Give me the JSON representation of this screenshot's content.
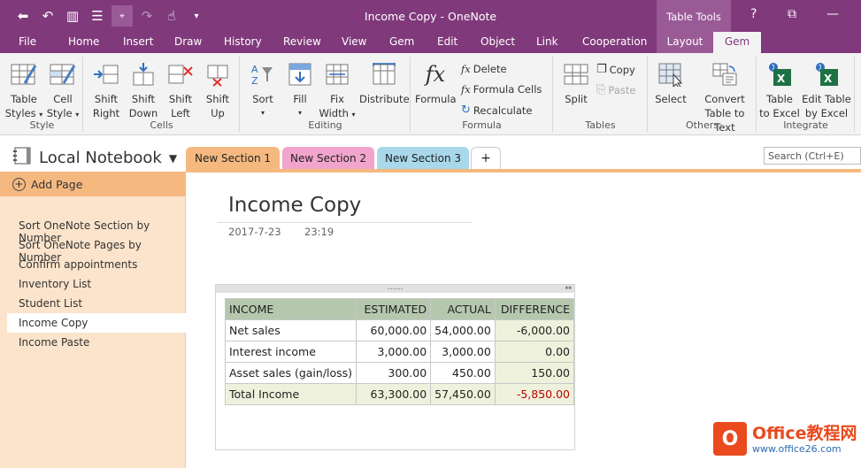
{
  "window": {
    "title": "Income Copy - OneNote",
    "context_tab_group": "Table Tools",
    "help": "?"
  },
  "ribbon_tabs": [
    "File",
    "Home",
    "Insert",
    "Draw",
    "History",
    "Review",
    "View",
    "Gem",
    "Edit",
    "Object",
    "Link",
    "Cooperation",
    "Layout",
    "Gem"
  ],
  "ribbon": {
    "style": {
      "label": "Style",
      "table_styles": [
        "Table",
        "Styles"
      ],
      "cell_style": [
        "Cell",
        "Style"
      ]
    },
    "cells": {
      "label": "Cells",
      "shift_right": [
        "Shift",
        "Right"
      ],
      "shift_down": [
        "Shift",
        "Down"
      ],
      "shift_left": [
        "Shift",
        "Left"
      ],
      "shift_up": [
        "Shift",
        "Up"
      ]
    },
    "editing": {
      "label": "Editing",
      "sort": "Sort",
      "fill": "Fill",
      "fix_width": [
        "Fix",
        "Width"
      ],
      "distribute": "Distribute"
    },
    "formula": {
      "label": "Formula",
      "formula": "Formula",
      "delete": "Delete",
      "formula_cells": "Formula Cells",
      "recalculate": "Recalculate"
    },
    "tables": {
      "label": "Tables",
      "split": "Split",
      "copy": "Copy",
      "paste": "Paste"
    },
    "others": {
      "label": "Others",
      "select": "Select",
      "convert": [
        "Convert",
        "Table to Text"
      ]
    },
    "integrate": {
      "label": "Integrate",
      "table_to_excel": [
        "Table",
        "to Excel"
      ],
      "edit_table": [
        "Edit Table",
        "by Excel"
      ]
    }
  },
  "notebook": {
    "name": "Local Notebook"
  },
  "sections": [
    {
      "label": "New Section 1",
      "color": "#f5b980"
    },
    {
      "label": "New Section 2",
      "color": "#f2a5cc"
    },
    {
      "label": "New Section 3",
      "color": "#a8d8ea"
    }
  ],
  "add_section": "+",
  "search": {
    "placeholder": "Search (Ctrl+E)"
  },
  "pages": {
    "add_page": "Add Page",
    "items": [
      "Sort OneNote Section by Number",
      "Sort OneNote Pages by Number",
      "Confirm appointments",
      "Inventory List",
      "Student List",
      "Income Copy",
      "Income Paste"
    ],
    "selected": "Income Copy"
  },
  "page": {
    "title": "Income Copy",
    "date": "2017-7-23",
    "time": "23:19"
  },
  "table": {
    "headers": [
      "INCOME",
      "ESTIMATED",
      "ACTUAL",
      "DIFFERENCE"
    ],
    "rows": [
      [
        "Net sales",
        "60,000.00",
        "54,000.00",
        "-6,000.00"
      ],
      [
        "Interest income",
        "3,000.00",
        "3,000.00",
        "0.00"
      ],
      [
        "Asset sales (gain/loss)",
        "300.00",
        "450.00",
        "150.00"
      ],
      [
        "Total Income",
        "63,300.00",
        "57,450.00",
        "-5,850.00"
      ]
    ]
  },
  "watermark": {
    "logo": "O",
    "line1": "Office教程网",
    "line2": "www.office26.com"
  },
  "colors": {
    "accent": "#80397b",
    "section_bar": "#f5b980",
    "page_pane": "#fce4cc",
    "negative": "#c00000"
  }
}
